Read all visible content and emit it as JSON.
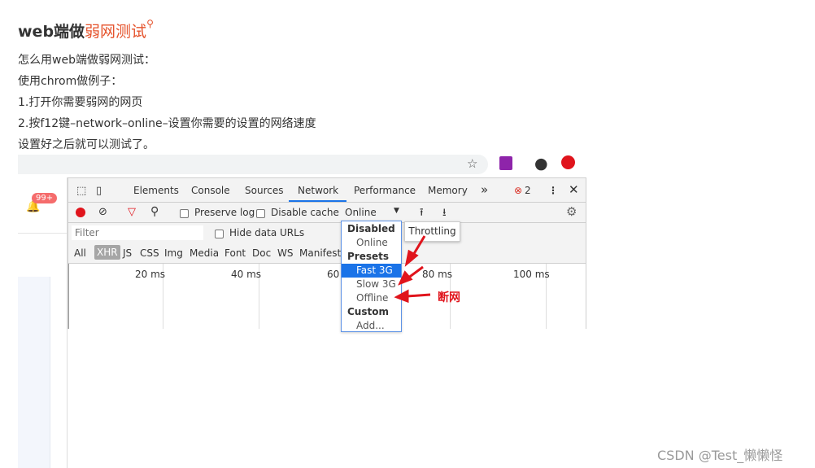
{
  "article": {
    "title_bold": "web端做",
    "title_link": "弱网测试",
    "paragraphs": [
      "怎么用web端做弱网测试：",
      "使用chrom做例子：",
      "1.打开你需要弱网的网页",
      "2.按f12键–network–online–设置你需要的设置的网络速度",
      "设置好之后就可以测试了。"
    ]
  },
  "app": {
    "notification_badge": "99+"
  },
  "devtools": {
    "tabs": [
      "Elements",
      "Console",
      "Sources",
      "Network",
      "Performance",
      "Memory"
    ],
    "active_tab": "Network",
    "more_tabs": "»",
    "error_count": "2",
    "toolbar": {
      "preserve_log": "Preserve log",
      "disable_cache": "Disable cache",
      "throttle_value": "Online"
    },
    "filter": {
      "placeholder": "Filter",
      "hide_data_urls": "Hide data URLs"
    },
    "type_filters": [
      "All",
      "XHR",
      "JS",
      "CSS",
      "Img",
      "Media",
      "Font",
      "Doc",
      "WS",
      "Manifest"
    ],
    "active_type": "XHR",
    "timeline_ticks": [
      "20 ms",
      "40 ms",
      "60",
      "80 ms",
      "100 ms"
    ],
    "throttle_menu": {
      "disabled_header": "Disabled",
      "online": "Online",
      "presets_header": "Presets",
      "fast3g": "Fast 3G",
      "slow3g": "Slow 3G",
      "offline": "Offline",
      "custom_header": "Custom",
      "add": "Add..."
    },
    "tooltip": "Throttling"
  },
  "annotation": "断网",
  "watermark": "CSDN @Test_懒懒怪",
  "colors": {
    "accent": "#1a73e8",
    "annotation": "#e0141c",
    "title_link": "#e5532c",
    "record": "#e0141c"
  }
}
